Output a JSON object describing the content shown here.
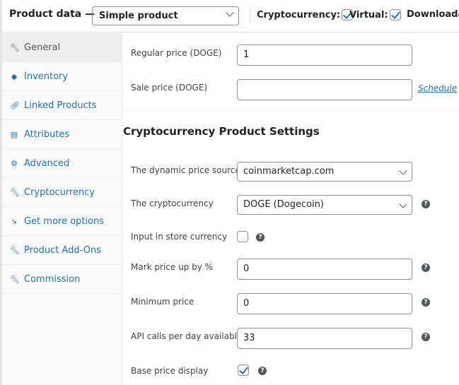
{
  "header": {
    "title": "Product data —",
    "product_type": "Simple product",
    "options": [
      {
        "label": "Cryptocurrency:",
        "checked": true
      },
      {
        "label": "Virtual:",
        "checked": true
      },
      {
        "label": "Downloadable",
        "checked": false
      }
    ]
  },
  "sidebar": {
    "items": [
      {
        "label": "General",
        "icon": "wrench-icon",
        "active": true
      },
      {
        "label": "Inventory",
        "icon": "inventory-icon"
      },
      {
        "label": "Linked Products",
        "icon": "link-icon"
      },
      {
        "label": "Attributes",
        "icon": "list-icon"
      },
      {
        "label": "Advanced",
        "icon": "gear-icon"
      },
      {
        "label": "Cryptocurrency",
        "icon": "wrench-icon"
      },
      {
        "label": "Get more options",
        "icon": "plugin-icon"
      },
      {
        "label": "Product Add-Ons",
        "icon": "wrench-icon"
      },
      {
        "label": "Commission",
        "icon": "wrench-icon"
      }
    ]
  },
  "general": {
    "regular_price_label": "Regular price (DOGE)",
    "regular_price": "1",
    "sale_price_label": "Sale price (DOGE)",
    "sale_price": "",
    "schedule": "Schedule"
  },
  "crypto": {
    "heading": "Cryptocurrency Product Settings",
    "source_label": "The dynamic price source",
    "source": "coinmarketcap.com",
    "currency_label": "The cryptocurrency",
    "currency": "DOGE (Dogecoin)",
    "store_currency_label": "Input in store currency",
    "store_currency": false,
    "markup_label": "Mark price up by %",
    "markup": "0",
    "min_label": "Minimum price",
    "min": "0",
    "api_label": "API calls per day available",
    "api": "33",
    "base_label": "Base price display",
    "base": true,
    "help": "?"
  }
}
